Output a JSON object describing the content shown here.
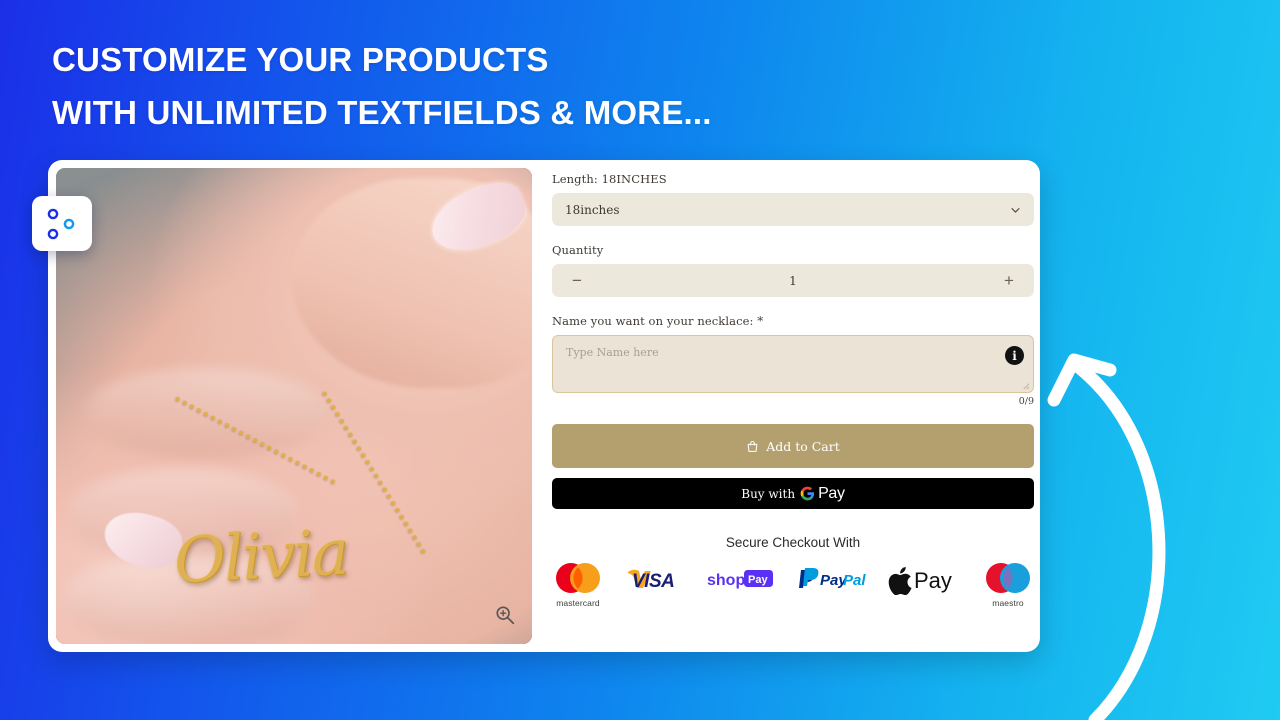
{
  "headline": {
    "line1": "CUSTOMIZE YOUR PRODUCTS",
    "line2": "WITH UNLIMITED TEXTFIELDS & MORE..."
  },
  "colors": {
    "bg_left": "#1b2fe8",
    "bg_right": "#1fcbf2",
    "field_bg": "#ede8dc",
    "textarea_bg": "#ebe4d6",
    "textarea_border": "#d9c79c",
    "add_to_cart": "#b4a06e",
    "gpay_bg": "#000000",
    "necklace_gold": "#e0b152"
  },
  "badge": {
    "icon": "sliders-settings-icon"
  },
  "product_image": {
    "alt": "hand-holding-gold-name-necklace",
    "necklace_name": "Olivia",
    "zoom_icon": "magnifier-zoom-in-icon"
  },
  "options": {
    "length": {
      "label": "Length: 18INCHES",
      "selected": "18inches",
      "options": [
        "18inches"
      ],
      "chevron": "chevron-down-icon"
    },
    "quantity": {
      "label": "Quantity",
      "value": "1",
      "decrement": "−",
      "increment": "+"
    },
    "name_field": {
      "label": "Name you want on your necklace:",
      "required_marker": "*",
      "placeholder": "Type Name here",
      "value": "",
      "counter": "0/9",
      "info_icon": "info-circle-icon",
      "info_glyph": "i"
    }
  },
  "actions": {
    "add_to_cart": "Add to Cart",
    "cart_icon": "shopping-bag-icon",
    "gpay_prefix": "Buy with",
    "gpay_word": "Pay",
    "gpay_icon": "google-g-icon"
  },
  "checkout": {
    "title": "Secure Checkout With",
    "methods": [
      {
        "name": "mastercard",
        "caption": "mastercard",
        "icon": "mastercard-icon"
      },
      {
        "name": "visa",
        "caption": "",
        "icon": "visa-icon"
      },
      {
        "name": "shop-pay",
        "caption": "",
        "icon": "shop-pay-icon"
      },
      {
        "name": "paypal",
        "caption": "",
        "icon": "paypal-icon"
      },
      {
        "name": "apple-pay",
        "caption": "",
        "icon": "apple-pay-icon"
      },
      {
        "name": "maestro",
        "caption": "maestro",
        "icon": "maestro-icon"
      }
    ]
  },
  "annotation": {
    "arrow": "curved-arrow-pointing-to-textfield"
  }
}
